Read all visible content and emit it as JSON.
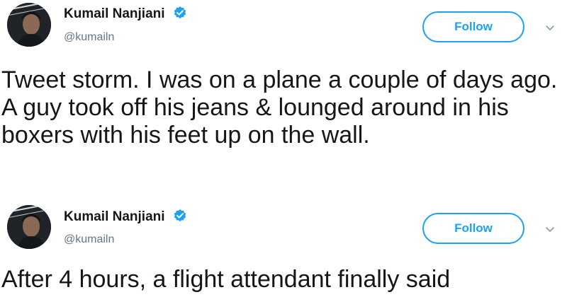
{
  "tweets": [
    {
      "author": {
        "name": "Kumail Nanjiani",
        "handle": "@kumailn",
        "verified": true,
        "avatar_icon": "profile-photo"
      },
      "follow_label": "Follow",
      "menu_icon": "chevron-down-icon",
      "text": "Tweet storm. I was on a plane a couple of days ago. A guy took off his jeans & lounged around in his boxers with his feet up on the wall."
    },
    {
      "author": {
        "name": "Kumail Nanjiani",
        "handle": "@kumailn",
        "verified": true,
        "avatar_icon": "profile-photo"
      },
      "follow_label": "Follow",
      "menu_icon": "chevron-down-icon",
      "text": "After 4 hours, a flight attendant finally said"
    }
  ],
  "colors": {
    "accent": "#1da1f2",
    "text": "#14171a",
    "secondary_text": "#657786",
    "chevron": "#8899a6"
  }
}
